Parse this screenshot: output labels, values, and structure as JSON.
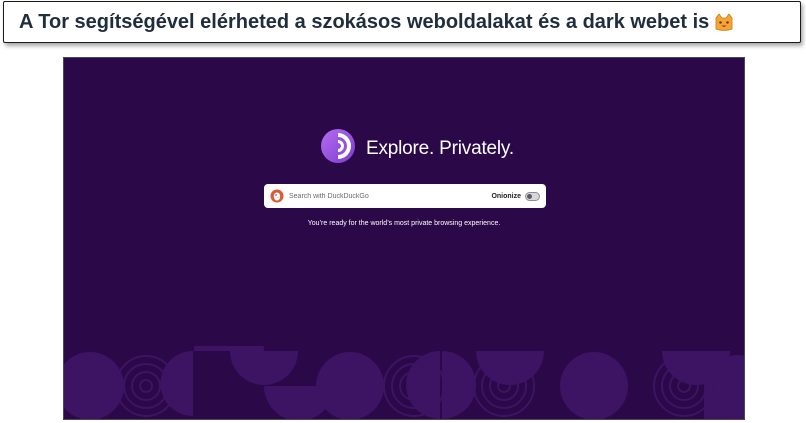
{
  "caption": {
    "text": "A Tor segítségével elérheted a szokásos weboldalakat és a dark webet is",
    "emoji_icon": "cat-face-icon"
  },
  "browser": {
    "brand": {
      "logo_icon": "tor-onion-icon",
      "title": "Explore. Privately."
    },
    "search": {
      "engine_icon": "duckduckgo-icon",
      "placeholder": "Search with DuckDuckGo",
      "value": "",
      "onionize_label": "Onionize",
      "onionize_enabled": false
    },
    "tagline": "You’re ready for the world’s most private browsing experience."
  },
  "colors": {
    "page_background": "#2b0848",
    "pattern": "#3d1363",
    "logo_gradient": [
      "#b36df0",
      "#7d3ccf"
    ],
    "ddg_orange": "#de5833"
  }
}
